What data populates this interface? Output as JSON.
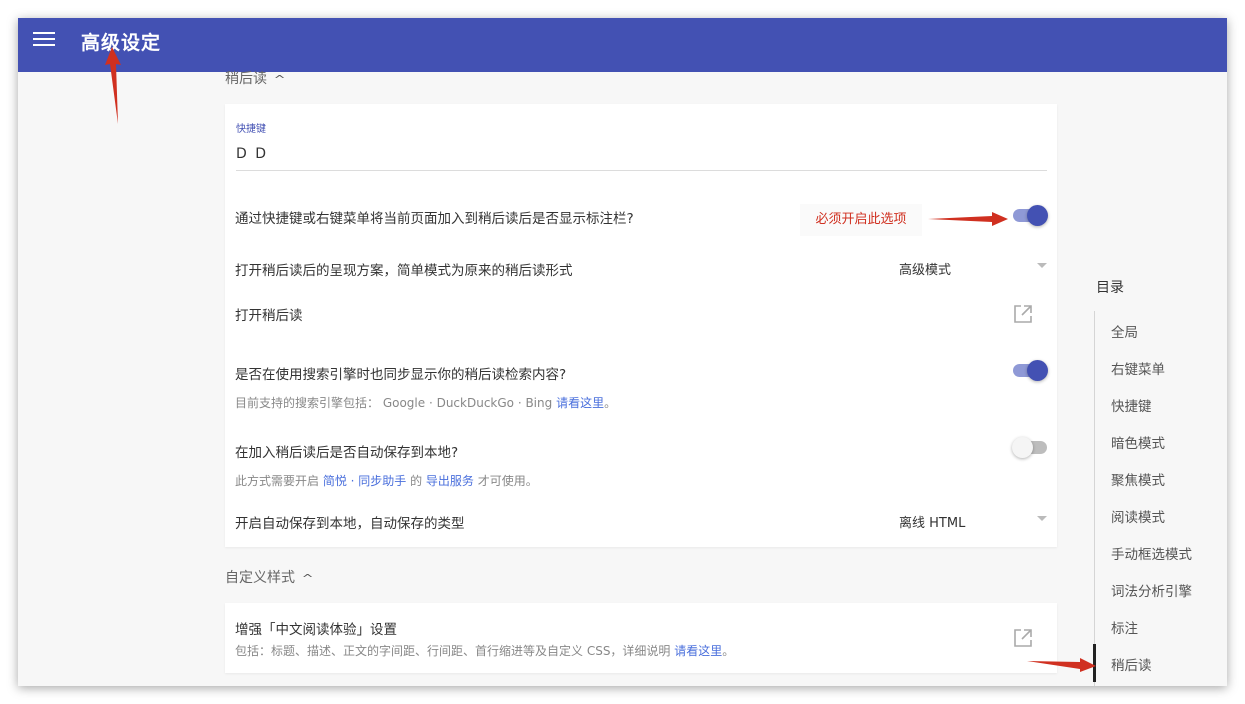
{
  "app": {
    "title": "高级设定",
    "menu_icon": "hamburger-menu-icon"
  },
  "read_later_section": {
    "title": "稍后读",
    "collapse_icon": "chevron-up-icon",
    "shortcut": {
      "label": "快捷键",
      "value": "D D"
    },
    "rows": {
      "show_annotation_bar": {
        "text": "通过快捷键或右键菜单将当前页面加入到稍后读后是否显示标注栏?",
        "toggle": true
      },
      "presentation": {
        "text": "打开稍后读后的呈现方案，简单模式为原来的稍后读形式",
        "selected": "高级模式"
      },
      "open_read_later": {
        "text": "打开稍后读",
        "icon": "open-in-new-icon"
      },
      "search_sync": {
        "text": "是否在使用搜索引擎时也同步显示你的稍后读检索内容?",
        "toggle": true,
        "sub_prefix": "目前支持的搜索引擎包括：  Google · DuckDuckGo · Bing ",
        "sub_link": "请看这里",
        "sub_suffix": "。"
      },
      "auto_save": {
        "text": "在加入稍后读后是否自动保存到本地?",
        "toggle": false,
        "sub_prefix": "此方式需要开启 ",
        "sub_link1": "简悦 · 同步助手",
        "sub_mid": " 的 ",
        "sub_link2": "导出服务",
        "sub_suffix": " 才可使用。"
      },
      "auto_save_type": {
        "text": "开启自动保存到本地，自动保存的类型",
        "selected": "离线 HTML"
      }
    }
  },
  "custom_style_section": {
    "title": "自定义样式",
    "collapse_icon": "chevron-up-icon",
    "enhance": {
      "text": "增强「中文阅读体验」设置",
      "sub_prefix": "包括：标题、描述、正文的字间距、行间距、首行缩进等及自定义 CSS，详细说明 ",
      "sub_link": "请看这里",
      "sub_suffix": "。",
      "icon": "open-in-new-icon"
    }
  },
  "toc": {
    "title": "目录",
    "items": [
      "全局",
      "右键菜单",
      "快捷键",
      "暗色模式",
      "聚焦模式",
      "阅读模式",
      "手动框选模式",
      "词法分析引擎",
      "标注",
      "稍后读"
    ],
    "active": "稍后读"
  },
  "annotations": {
    "note": "必须开启此选项",
    "color": "#d03020"
  },
  "colors": {
    "appbar": "#4351b3",
    "accent": "#4351b3",
    "link": "#4a6fdc"
  }
}
